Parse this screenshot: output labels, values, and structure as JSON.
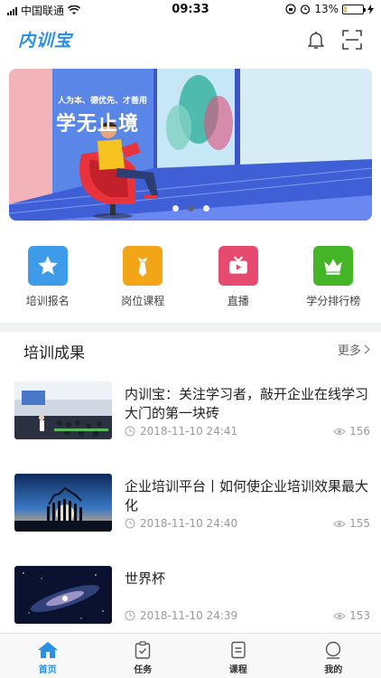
{
  "status_bar": {
    "carrier": "中国联通",
    "time": "09:33",
    "battery_percent": "13%",
    "battery_level": 0.13
  },
  "header": {
    "logo_text": "内训宝",
    "icons": [
      "bell-icon",
      "scan-icon"
    ]
  },
  "banner": {
    "tagline": "人为本、德优先、才善用",
    "headline": "学无止境",
    "slide_count": 3,
    "active_slide": 2
  },
  "quick_nav": [
    {
      "label": "培训报名",
      "icon": "star-icon",
      "color": "#3d9be9"
    },
    {
      "label": "岗位课程",
      "icon": "tie-icon",
      "color": "#f2a516"
    },
    {
      "label": "直播",
      "icon": "tv-icon",
      "color": "#e64a6e"
    },
    {
      "label": "学分排行榜",
      "icon": "crown-icon",
      "color": "#43b526"
    }
  ],
  "section": {
    "title": "培训成果",
    "more_label": "更多"
  },
  "articles": [
    {
      "title": "内训宝：关注学习者，敲开企业在线学习大门的第一块砖",
      "date": "2018-11-10 24:41",
      "views": "156"
    },
    {
      "title": "企业培训平台丨如何使企业培训效果最大化",
      "date": "2018-11-10 24:40",
      "views": "155"
    },
    {
      "title": "世界杯",
      "date": "2018-11-10 24:39",
      "views": "153"
    }
  ],
  "tabbar": [
    {
      "label": "首页",
      "icon": "home-icon",
      "active": true
    },
    {
      "label": "任务",
      "icon": "task-icon",
      "active": false
    },
    {
      "label": "课程",
      "icon": "course-icon",
      "active": false
    },
    {
      "label": "我的",
      "icon": "profile-icon",
      "active": false
    }
  ],
  "colors": {
    "accent": "#2b8fe3",
    "divider": "#f1f2f4",
    "meta_text": "#9a9a9a"
  }
}
